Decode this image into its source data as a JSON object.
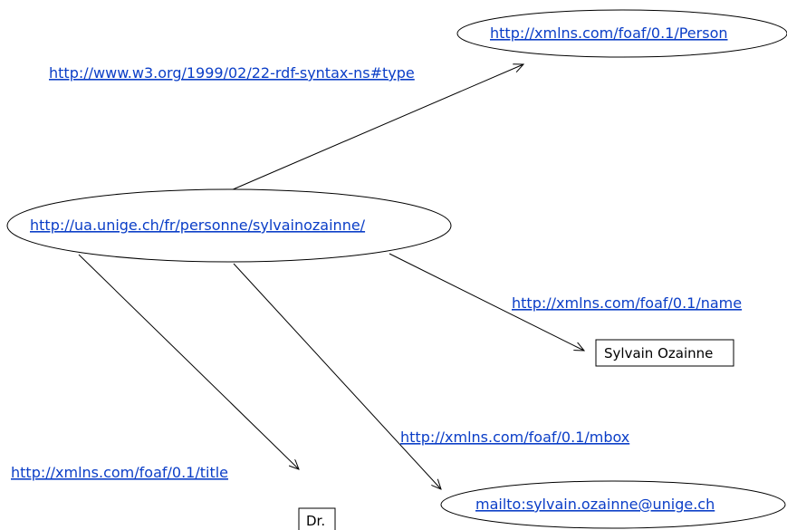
{
  "colors": {
    "link": "#0b3ec7",
    "stroke": "#000000",
    "background": "#ffffff"
  },
  "nodes": {
    "subject": "http://ua.unige.ch/fr/personne/sylvainozainne/",
    "person_class": "http://xmlns.com/foaf/0.1/Person",
    "name_value": "Sylvain Ozainne",
    "title_value": "Dr.",
    "mbox_value": "mailto:sylvain.ozainne@unige.ch"
  },
  "edges": {
    "type": "http://www.w3.org/1999/02/22-rdf-syntax-ns#type",
    "name": "http://xmlns.com/foaf/0.1/name",
    "mbox": "http://xmlns.com/foaf/0.1/mbox",
    "title": "http://xmlns.com/foaf/0.1/title"
  }
}
